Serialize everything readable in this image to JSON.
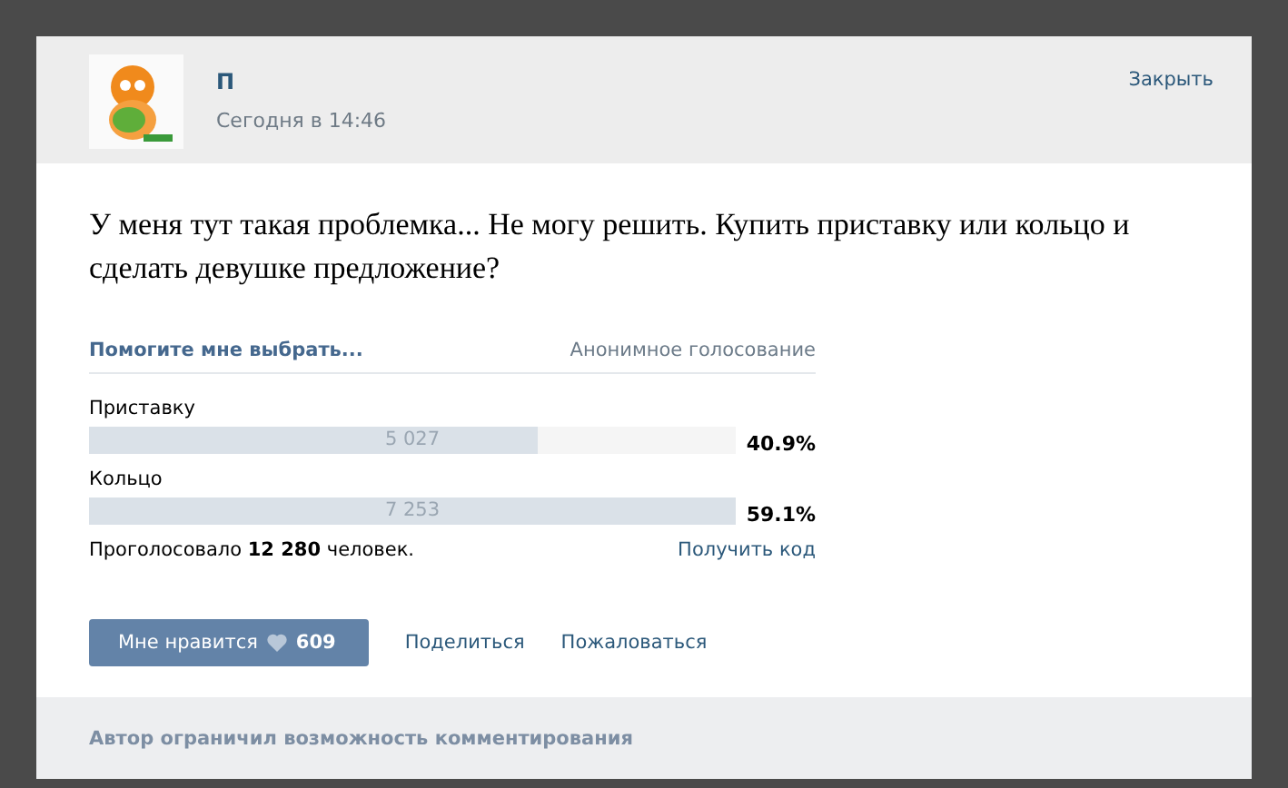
{
  "post": {
    "author": "П",
    "time": "Сегодня в 14:46",
    "close": "Закрыть",
    "text": "У меня тут такая проблемка... Не могу решить. Купить приставку или кольцо и сделать девушке предложение?"
  },
  "poll": {
    "title": "Помогите мне выбрать...",
    "type": "Анонимное голосование",
    "options": [
      {
        "label": "Приставку",
        "count": "5 027",
        "level": 0.693,
        "percent": "40.9%"
      },
      {
        "label": "Кольцо",
        "count": "7 253",
        "level": 1,
        "percent": "59.1%"
      }
    ],
    "total": "Проголосовало **12 280** человек.",
    "get_code": "Получить код"
  },
  "actions": {
    "like": {
      "label": "Мне нравится",
      "count": "609"
    },
    "share": "Поделиться",
    "report": "Пожаловаться"
  },
  "footer": "Автор ограничил возможность комментирования"
}
